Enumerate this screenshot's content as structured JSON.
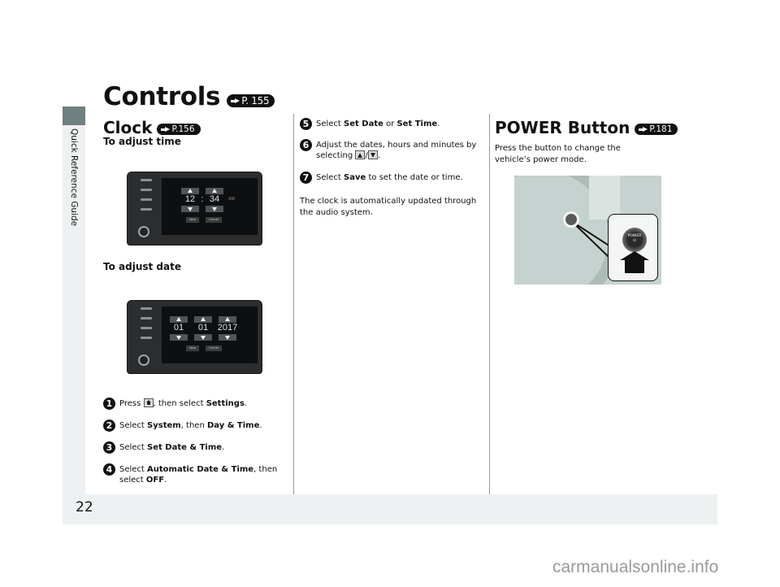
{
  "sidebar": {
    "label": "Quick Reference Guide"
  },
  "page": {
    "title": "Controls",
    "title_ref": "P. 155",
    "number": "22"
  },
  "clock": {
    "heading": "Clock",
    "ref": "P.156",
    "adjust_time": {
      "heading": "To adjust time",
      "hour": "12",
      "separator": ":",
      "minute": "34",
      "ampm": "AM",
      "save": "Save",
      "cancel": "Cancel"
    },
    "adjust_date": {
      "heading": "To adjust date",
      "month": "01",
      "day": "01",
      "year": "2017",
      "save": "Save",
      "cancel": "Cancel"
    },
    "steps": [
      {
        "num": "1",
        "pre": "Press ",
        "icon": "home-icon",
        "mid": ", then select ",
        "b1": "Settings",
        "post": "."
      },
      {
        "num": "2",
        "pre": "Select ",
        "b1": "System",
        "mid": ", then ",
        "b2": "Day & Time",
        "post": "."
      },
      {
        "num": "3",
        "pre": "Select ",
        "b1": "Set Date & Time",
        "post": "."
      },
      {
        "num": "4",
        "pre": "Select ",
        "b1": "Automatic Date & Time",
        "mid": ", then select ",
        "b2": "OFF",
        "post": "."
      },
      {
        "num": "5",
        "pre": "Select ",
        "b1": "Set Date",
        "mid": " or ",
        "b2": "Set Time",
        "post": "."
      },
      {
        "num": "6",
        "pre": "Adjust the dates, hours and minutes by selecting ",
        "post": "."
      },
      {
        "num": "7",
        "pre": "Select ",
        "b1": "Save",
        "post": " to set the date or time."
      }
    ],
    "note": "The clock is automatically updated through the audio system."
  },
  "power": {
    "heading": "POWER Button",
    "ref": "P.181",
    "description": "Press the button to change the vehicle’s power mode.",
    "button_label": "POWER"
  },
  "watermark": "carmanualsonline.info"
}
